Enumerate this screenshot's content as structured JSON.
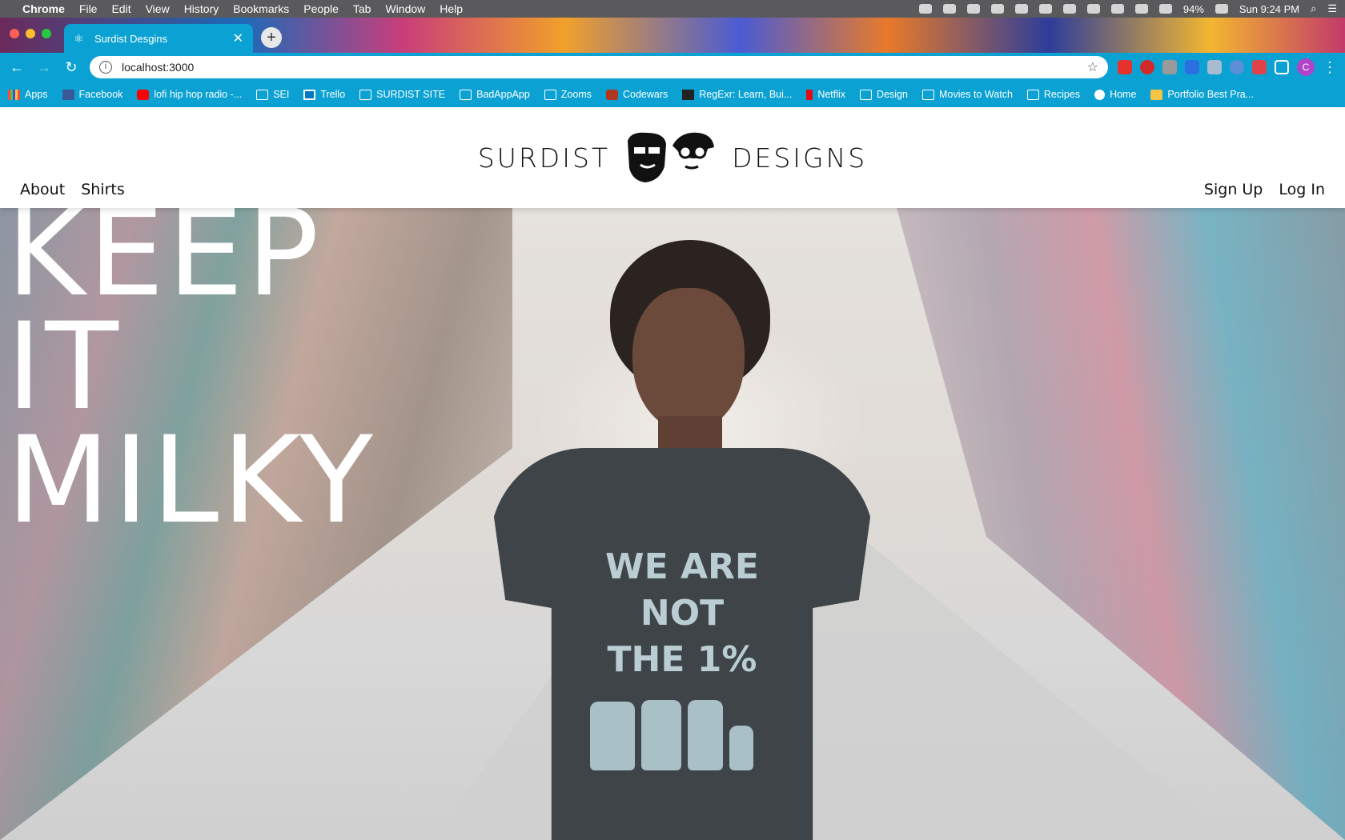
{
  "menubar": {
    "app_name": "Chrome",
    "menus": [
      "File",
      "Edit",
      "View",
      "History",
      "Bookmarks",
      "People",
      "Tab",
      "Window",
      "Help"
    ],
    "battery": "94%",
    "clock": "Sun 9:24 PM"
  },
  "browser": {
    "tab": {
      "title": "Surdist Desgins",
      "favicon": "react-icon"
    },
    "url": "localhost:3000",
    "profile_initial": "C",
    "bookmarks": [
      {
        "label": "Apps",
        "icon": "apps-grid-icon"
      },
      {
        "label": "Facebook",
        "icon": "facebook-icon"
      },
      {
        "label": "lofi hip hop radio -...",
        "icon": "youtube-icon"
      },
      {
        "label": "SEI",
        "icon": "folder-icon"
      },
      {
        "label": "Trello",
        "icon": "trello-icon"
      },
      {
        "label": "SURDIST SITE",
        "icon": "folder-icon"
      },
      {
        "label": "BadAppApp",
        "icon": "folder-icon"
      },
      {
        "label": "Zooms",
        "icon": "folder-icon"
      },
      {
        "label": "Codewars",
        "icon": "codewars-icon"
      },
      {
        "label": "RegExr: Learn, Bui...",
        "icon": "regexr-icon"
      },
      {
        "label": "Netflix",
        "icon": "netflix-icon"
      },
      {
        "label": "Design",
        "icon": "folder-icon"
      },
      {
        "label": "Movies to Watch",
        "icon": "folder-icon"
      },
      {
        "label": "Recipes",
        "icon": "folder-icon"
      },
      {
        "label": "Home",
        "icon": "home-globe-icon"
      },
      {
        "label": "Portfolio Best Pra...",
        "icon": "bookmark-page-icon"
      }
    ]
  },
  "site": {
    "brand_left": "SURDIST",
    "brand_right": "DESIGNS",
    "nav_left": [
      "About",
      "Shirts"
    ],
    "nav_right": [
      "Sign Up",
      "Log In"
    ],
    "hero_lines": [
      "KEEP",
      "IT",
      "MILKY"
    ],
    "shirt_text": [
      "WE ARE",
      "NOT",
      "THE 1%"
    ]
  },
  "colors": {
    "menubar": "#5a5a5c",
    "chrome_accent": "#0ba2d3",
    "hero_text": "#ffffff"
  }
}
